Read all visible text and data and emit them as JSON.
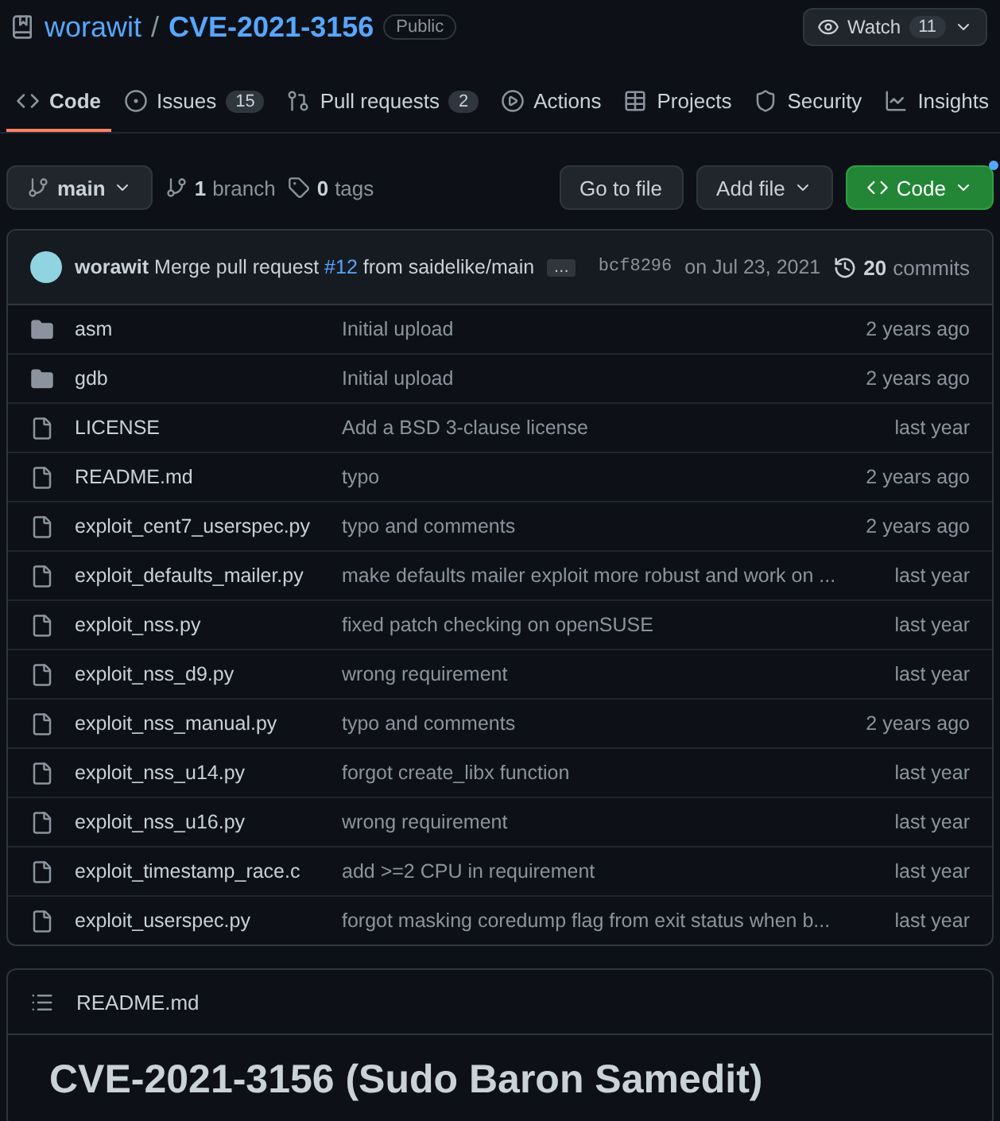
{
  "repo": {
    "owner": "worawit",
    "separator": "/",
    "name": "CVE-2021-3156",
    "visibility": "Public"
  },
  "watch": {
    "label": "Watch",
    "count": "11"
  },
  "tabs": [
    {
      "label": "Code",
      "kind": "code",
      "selected": true
    },
    {
      "label": "Issues",
      "kind": "issue",
      "count": "15",
      "selected": false
    },
    {
      "label": "Pull requests",
      "kind": "pr",
      "count": "2",
      "selected": false
    },
    {
      "label": "Actions",
      "kind": "play",
      "selected": false
    },
    {
      "label": "Projects",
      "kind": "table",
      "selected": false
    },
    {
      "label": "Security",
      "kind": "shield",
      "selected": false
    },
    {
      "label": "Insights",
      "kind": "graph",
      "selected": false
    }
  ],
  "branch_select": "main",
  "branches": {
    "count": "1",
    "label": "branch"
  },
  "tags": {
    "count": "0",
    "label": "tags"
  },
  "buttons": {
    "go_to_file": "Go to file",
    "add_file": "Add file",
    "code": "Code"
  },
  "commit": {
    "author": "worawit",
    "message_before": "Merge pull request ",
    "link": "#12",
    "message_after": " from saidelike/main",
    "more": "…",
    "sha": "bcf8296",
    "date": "on Jul 23, 2021",
    "count": "20",
    "count_label": "commits"
  },
  "files": [
    {
      "kind": "dir",
      "name": "asm",
      "message": "Initial upload",
      "age": "2 years ago"
    },
    {
      "kind": "dir",
      "name": "gdb",
      "message": "Initial upload",
      "age": "2 years ago"
    },
    {
      "kind": "file",
      "name": "LICENSE",
      "message": "Add a BSD 3-clause license",
      "age": "last year"
    },
    {
      "kind": "file",
      "name": "README.md",
      "message": "typo",
      "age": "2 years ago"
    },
    {
      "kind": "file",
      "name": "exploit_cent7_userspec.py",
      "message": "typo and comments",
      "age": "2 years ago"
    },
    {
      "kind": "file",
      "name": "exploit_defaults_mailer.py",
      "message": "make defaults mailer exploit more robust and work on ...",
      "age": "last year"
    },
    {
      "kind": "file",
      "name": "exploit_nss.py",
      "message": "fixed patch checking on openSUSE",
      "age": "last year"
    },
    {
      "kind": "file",
      "name": "exploit_nss_d9.py",
      "message": "wrong requirement",
      "age": "last year"
    },
    {
      "kind": "file",
      "name": "exploit_nss_manual.py",
      "message": "typo and comments",
      "age": "2 years ago"
    },
    {
      "kind": "file",
      "name": "exploit_nss_u14.py",
      "message": "forgot create_libx function",
      "age": "last year"
    },
    {
      "kind": "file",
      "name": "exploit_nss_u16.py",
      "message": "wrong requirement",
      "age": "last year"
    },
    {
      "kind": "file",
      "name": "exploit_timestamp_race.c",
      "message": "add >=2 CPU in requirement",
      "age": "last year"
    },
    {
      "kind": "file",
      "name": "exploit_userspec.py",
      "message": "forgot masking coredump flag from exit status when b...",
      "age": "last year"
    }
  ],
  "readme": {
    "filename": "README.md",
    "heading": "CVE-2021-3156 (Sudo Baron Samedit)"
  }
}
